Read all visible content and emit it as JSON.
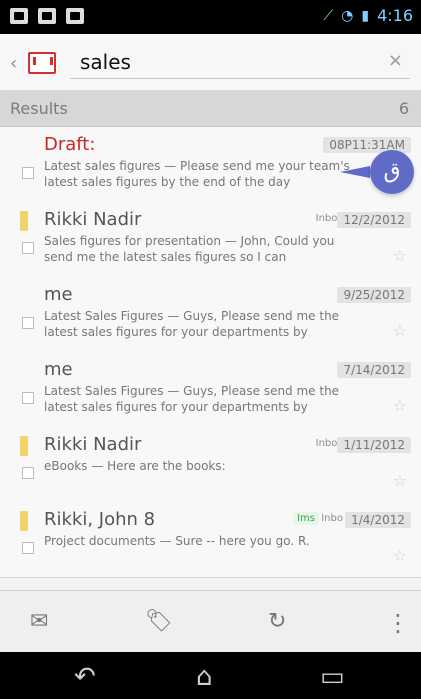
{
  "status_bar": {
    "time": "4:16"
  },
  "search": {
    "query": "sales",
    "clear_label": "×"
  },
  "results": {
    "label": "Results",
    "count": "6"
  },
  "emails": [
    {
      "sender": "Draft:",
      "date": "08P11:31AM",
      "snippet": "Latest sales figures — Please send me your team's latest sales figures by the end of the day"
    },
    {
      "sender": "Rikki Nadir",
      "inbox": "Inbox",
      "date": "12/2/2012",
      "snippet": "Sales figures for presentation — John, Could you send me the latest sales figures so I can"
    },
    {
      "sender": "me",
      "date": "9/25/2012",
      "snippet": "Latest Sales Figures — Guys, Please send me the latest sales figures for your departments by"
    },
    {
      "sender": "me",
      "date": "7/14/2012",
      "snippet": "Latest Sales Figures — Guys, Please send me the latest sales figures for your departments by"
    },
    {
      "sender": "Rikki Nadir",
      "inbox": "Inbox",
      "date": "1/11/2012",
      "snippet": "eBooks — Here are the books:"
    },
    {
      "sender": "Rikki, John 8",
      "tag": "Ims",
      "inbox": "Inbo",
      "date": "1/4/2012",
      "snippet": "Project documents — Sure -- here you go. R."
    }
  ],
  "toolbar": {
    "compose_icon": "compose-mail-icon",
    "labels_icon": "labels-icon",
    "refresh_icon": "refresh-icon",
    "more_icon": "more-options-icon"
  },
  "nav": {
    "back_icon": "back-icon",
    "home_icon": "home-icon",
    "recent_icon": "recent-apps-icon"
  },
  "colors": {
    "draft": "#c62828",
    "fab": "#5f6bc6",
    "status_icons": "#7fd0ff"
  }
}
